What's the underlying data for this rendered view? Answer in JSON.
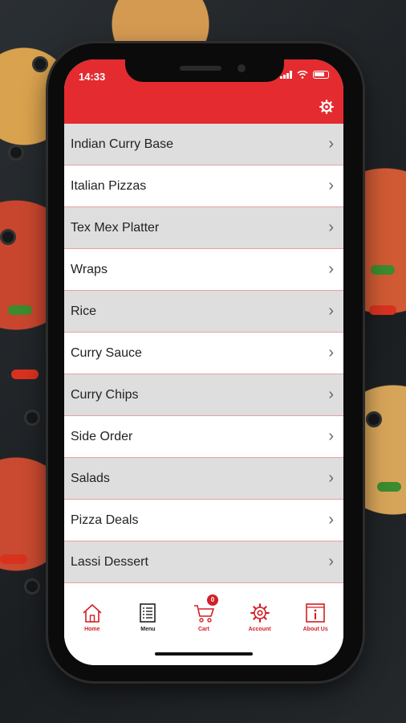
{
  "status_bar": {
    "time": "14:33"
  },
  "header": {
    "settings_icon": "gear-icon",
    "accent_color": "#e42b2f"
  },
  "menu": {
    "items": [
      {
        "label": "Indian Curry Base"
      },
      {
        "label": "Italian Pizzas"
      },
      {
        "label": "Tex Mex Platter"
      },
      {
        "label": "Wraps"
      },
      {
        "label": "Rice"
      },
      {
        "label": "Curry Sauce"
      },
      {
        "label": "Curry Chips"
      },
      {
        "label": "Side Order"
      },
      {
        "label": "Salads"
      },
      {
        "label": "Pizza Deals"
      },
      {
        "label": "Lassi Dessert"
      }
    ],
    "chevron": "›"
  },
  "tabbar": {
    "home": "Home",
    "menu": "Menu",
    "cart": "Cart",
    "cart_count": "0",
    "account": "Account",
    "about": "About Us"
  }
}
